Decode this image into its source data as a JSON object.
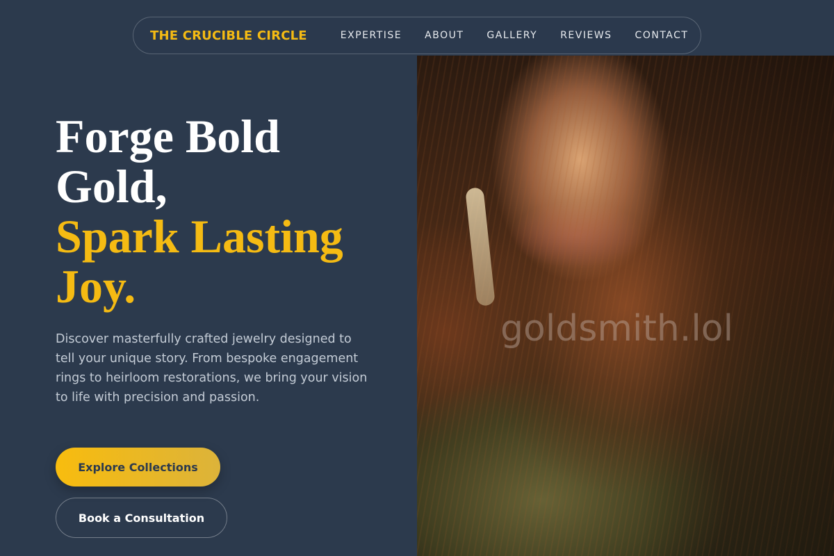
{
  "nav": {
    "brand": "THE CRUCIBLE CIRCLE",
    "links": [
      "EXPERTISE",
      "ABOUT",
      "GALLERY",
      "REVIEWS",
      "CONTACT"
    ]
  },
  "hero": {
    "headline_line1": "Forge Bold",
    "headline_line2": "Gold,",
    "headline_line3": "Spark Lasting",
    "headline_line4": "Joy.",
    "description": "Discover masterfully crafted jewelry designed to tell your unique story. From bespoke engagement rings to heirloom restorations, we bring your vision to life with precision and passion.",
    "primary_button": "Explore Collections",
    "secondary_button": "Book a Consultation"
  },
  "image": {
    "watermark": "goldsmith.lol"
  },
  "colors": {
    "background": "#2c3a4d",
    "accent_gold": "#f5bb13",
    "text_light": "#ffffff"
  }
}
